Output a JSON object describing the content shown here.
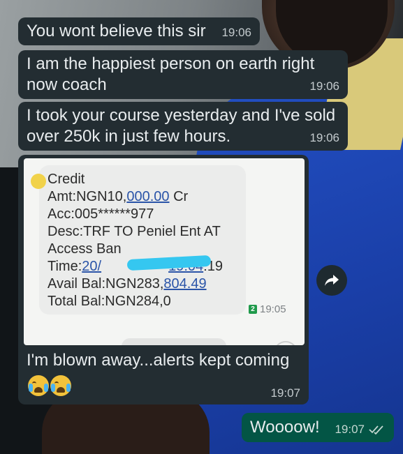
{
  "messages": [
    {
      "text": "You wont believe this sir",
      "time": "19:06"
    },
    {
      "text": "I am the happiest person on earth right now coach",
      "time": "19:06"
    },
    {
      "text": "I took your course yesterday and I've sold over 250k in just few hours.",
      "time": "19:06"
    }
  ],
  "image_message": {
    "sms_lines": {
      "l1": "Credit",
      "l2a": "Amt:NGN10,",
      "l2b": "000.00",
      "l2c": " Cr",
      "l3": "Acc:005******977",
      "l4": "Desc:TRF TO Peniel Ent AT",
      "l5": "Access Ban",
      "l6a": "Time:",
      "l6b": "20/",
      "l6c": "19:04",
      "l6d": ":19",
      "l7a": "Avail Bal:NGN283,",
      "l7b": "804.49",
      "l8": "Total Bal:NGN284,0"
    },
    "sms_time": "19:05",
    "sim_label": "2",
    "caption": "I'm blown away...alerts kept coming",
    "emojis": [
      "crying-face-icon",
      "crying-face-icon"
    ],
    "time": "19:07"
  },
  "sent_message": {
    "text": "Woooow!",
    "time": "19:07",
    "status": "read"
  },
  "colors": {
    "incoming_bubble": "#232d32",
    "outgoing_bubble": "#035545",
    "link_blue": "#2a54a8",
    "redaction": "#35c7f0"
  }
}
